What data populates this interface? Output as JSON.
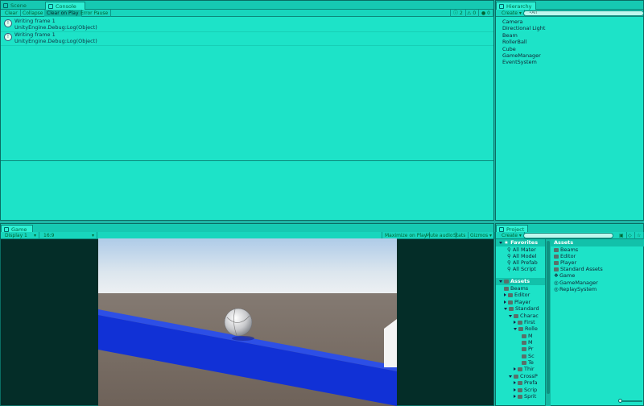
{
  "console_panel": {
    "tabs": [
      {
        "label": "Scene"
      },
      {
        "label": "Console"
      }
    ],
    "toolbar": {
      "buttons": [
        {
          "label": "Clear"
        },
        {
          "label": "Collapse"
        },
        {
          "label": "Clear on Play"
        },
        {
          "label": "Error Pause"
        }
      ],
      "counts": {
        "info": "2",
        "warning": "0",
        "error": "0"
      }
    },
    "entries": [
      {
        "line1": "Writing frame 1",
        "line2": "UnityEngine.Debug:Log(Object)"
      },
      {
        "line1": "Writing frame 1",
        "line2": "UnityEngine.Debug:Log(Object)"
      }
    ]
  },
  "hierarchy_panel": {
    "tab": "Hierarchy",
    "create_label": "Create",
    "search_placeholder": "•All",
    "items": [
      "Camera",
      "Directional Light",
      "Beam",
      "RollerBall",
      "Cube",
      "GameManager",
      "EventSystem"
    ]
  },
  "game_panel": {
    "tab": "Game",
    "display": "Display 1",
    "aspect": "16:9",
    "buttons": [
      {
        "label": "Maximize on Play"
      },
      {
        "label": "Mute audio"
      },
      {
        "label": "Stats"
      },
      {
        "label": "Gizmos"
      }
    ]
  },
  "project_panel": {
    "tab": "Project",
    "create_label": "Create",
    "favorites": {
      "label": "Favorites",
      "items": [
        "All Mater",
        "All Model",
        "All Prefab",
        "All Script"
      ]
    },
    "tree": {
      "root": "Assets",
      "items": [
        {
          "label": "Beams",
          "depth": 1
        },
        {
          "label": "Editor",
          "depth": 1
        },
        {
          "label": "Player",
          "depth": 1
        },
        {
          "label": "Standard",
          "depth": 1
        },
        {
          "label": "Charac",
          "depth": 2
        },
        {
          "label": "First",
          "depth": 3
        },
        {
          "label": "Rolle",
          "depth": 3
        },
        {
          "label": "M",
          "depth": 4
        },
        {
          "label": "M",
          "depth": 4
        },
        {
          "label": "Pr",
          "depth": 4
        },
        {
          "label": "Sc",
          "depth": 4
        },
        {
          "label": "Te",
          "depth": 4
        },
        {
          "label": "Thir",
          "depth": 3
        },
        {
          "label": "CrossP",
          "depth": 2
        },
        {
          "label": "Prefa",
          "depth": 3
        },
        {
          "label": "Scrip",
          "depth": 3
        },
        {
          "label": "Sprit",
          "depth": 3
        }
      ]
    },
    "assets": {
      "header": "Assets",
      "items": [
        {
          "label": "Beams",
          "kind": "folder"
        },
        {
          "label": "Editor",
          "kind": "folder"
        },
        {
          "label": "Player",
          "kind": "folder"
        },
        {
          "label": "Standard Assets",
          "kind": "folder"
        },
        {
          "label": "Game",
          "kind": "scene"
        },
        {
          "label": "GameManager",
          "kind": "script"
        },
        {
          "label": "ReplaySystem",
          "kind": "script"
        }
      ]
    }
  }
}
